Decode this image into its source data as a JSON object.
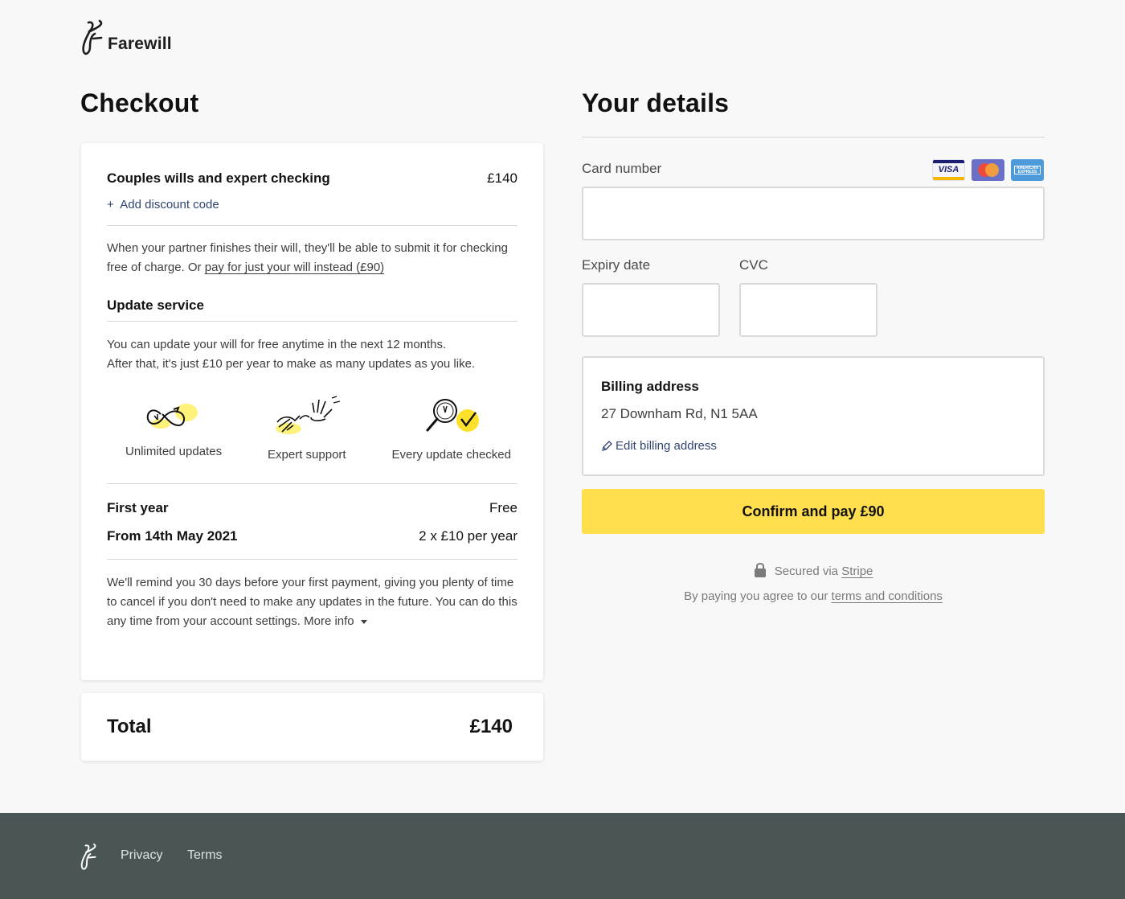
{
  "brand": {
    "name": "Farewill",
    "logo_icon": "farewill-squiggle-logo"
  },
  "checkout": {
    "title": "Checkout",
    "product": {
      "name": "Couples wills and expert checking",
      "price": "£140"
    },
    "discount": {
      "plus": "+",
      "label": "Add discount code"
    },
    "partner_note": {
      "text": "When your partner finishes their will, they'll be able to submit it for checking free of charge. Or",
      "link": "pay for just your will instead (£90)"
    },
    "update_service": {
      "heading": "Update service",
      "line1": "You can update your will for free anytime in the next 12 months.",
      "line2": "After that, it's just £10 per year to make as many updates as you like.",
      "features": [
        {
          "label": "Unlimited updates",
          "icon": "infinity-clock-icon"
        },
        {
          "label": "Expert support",
          "icon": "waving-hand-icon"
        },
        {
          "label": "Every update checked",
          "icon": "magnifier-check-icon"
        }
      ],
      "first_year": {
        "label": "First year",
        "value": "Free"
      },
      "from": {
        "label": "From 14th May 2021",
        "value": "2 x £10 per year"
      },
      "reminder": "We'll remind you 30 days before your first payment, giving you plenty of time to cancel if you don't need to make any updates in the future. You can do this any time from your account settings.",
      "more_info": "More info"
    },
    "total": {
      "label": "Total",
      "value": "£140"
    }
  },
  "details": {
    "title": "Your details",
    "card_number": {
      "label": "Card number",
      "value": ""
    },
    "card_brands": [
      "visa-icon",
      "mastercard-icon",
      "amex-icon"
    ],
    "expiry": {
      "label": "Expiry date",
      "value": ""
    },
    "cvc": {
      "label": "CVC",
      "value": ""
    },
    "billing": {
      "heading": "Billing address",
      "address": "27 Downham Rd, N1 5AA",
      "edit": "Edit billing address"
    },
    "pay_button": "Confirm and pay £90",
    "secured_prefix": "Secured via",
    "secured_link": "Stripe",
    "agree_prefix": "By paying you agree to our",
    "agree_link": "terms and conditions"
  },
  "footer": {
    "privacy": "Privacy",
    "terms": "Terms"
  },
  "colors": {
    "accent": "#ffdf4d",
    "footer": "#4a5556",
    "link": "#2f4572"
  }
}
